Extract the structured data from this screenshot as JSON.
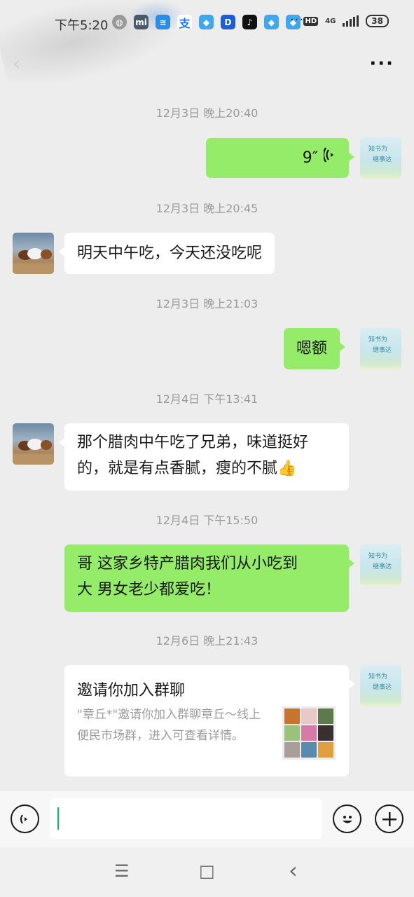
{
  "status_bar": {
    "time": "下午5:20",
    "network": "4G",
    "battery": "38",
    "hd_label": "HD",
    "more_notifications": "···",
    "app_icons": [
      "globe-icon",
      "mi-store-icon",
      "wifi-app-icon",
      "alipay-icon",
      "cloud-app-icon",
      "d-app-icon",
      "tiktok-icon",
      "cloud-app-icon",
      "cloud-app-icon"
    ]
  },
  "header": {
    "back_label": "‹",
    "more_label": "···"
  },
  "avatars": {
    "self_text_line1": "知书为",
    "self_text_line2": "继事达"
  },
  "messages": [
    {
      "timestamp": "12月3日 晚上20:40"
    },
    {
      "side": "right",
      "type": "voice",
      "duration": "9″"
    },
    {
      "timestamp": "12月3日 晚上20:45"
    },
    {
      "side": "left",
      "type": "text",
      "text": "明天中午吃，今天还没吃呢"
    },
    {
      "timestamp": "12月3日 晚上21:03"
    },
    {
      "side": "right",
      "type": "text",
      "text": "嗯额"
    },
    {
      "timestamp": "12月4日 下午13:41"
    },
    {
      "side": "left",
      "type": "text",
      "line1": "那个腊肉中午吃了兄弟，味道挺好",
      "line2": "的，就是有点香腻，瘦的不腻",
      "emoji": "👍"
    },
    {
      "timestamp": "12月4日 下午15:50"
    },
    {
      "side": "right",
      "type": "text",
      "line1": "哥 这家乡特产腊肉我们从小吃到",
      "line2": "大 男女老少都爱吃！"
    },
    {
      "timestamp": "12月6日 晚上21:43"
    },
    {
      "side": "right",
      "type": "invite",
      "title": "邀请你加入群聊",
      "desc": "\"章丘*\"邀请你加入群聊章丘～线上便民市场群，进入可查看详情。"
    }
  ],
  "input_bar": {
    "voice_icon": "voice-icon",
    "emoji_icon": "emoji-icon",
    "plus_icon": "plus-icon",
    "text_value": ""
  },
  "nav_bar": {
    "menu": "☰",
    "home": "□",
    "back": "‹"
  },
  "colors": {
    "background": "#ededed",
    "self_bubble": "#95ec69",
    "other_bubble": "#ffffff",
    "timestamp": "#9a9a9a",
    "cursor": "#07c160"
  }
}
